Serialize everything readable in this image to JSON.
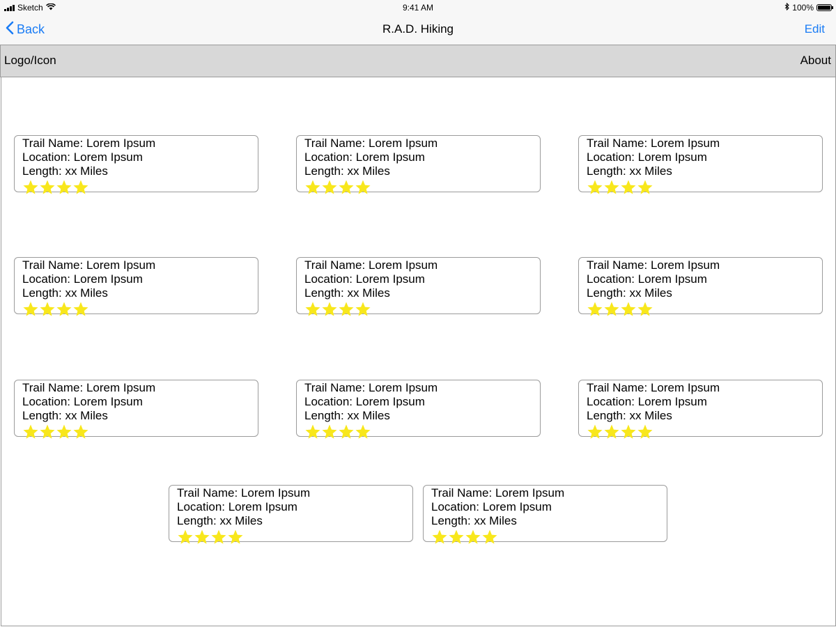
{
  "status_bar": {
    "carrier": "Sketch",
    "time": "9:41 AM",
    "battery_text": "100%",
    "battery_level": 1.0
  },
  "nav": {
    "back_label": "Back",
    "title": "R.A.D. Hiking",
    "edit_label": "Edit"
  },
  "header": {
    "logo_label": "Logo/Icon",
    "about_label": "About"
  },
  "colors": {
    "accent": "#1a7cf5",
    "star": "#f8e71c",
    "header_bg": "#d8d8d8"
  },
  "trails": [
    {
      "name": "Trail Name: Lorem Ipsum",
      "location": "Location: Lorem Ipsum",
      "length": "Length: xx Miles",
      "rating": 4
    },
    {
      "name": "Trail Name: Lorem Ipsum",
      "location": "Location: Lorem Ipsum",
      "length": "Length: xx Miles",
      "rating": 4
    },
    {
      "name": "Trail Name: Lorem Ipsum",
      "location": "Location: Lorem Ipsum",
      "length": "Length: xx Miles",
      "rating": 4
    },
    {
      "name": "Trail Name: Lorem Ipsum",
      "location": "Location: Lorem Ipsum",
      "length": "Length: xx Miles",
      "rating": 4
    },
    {
      "name": "Trail Name: Lorem Ipsum",
      "location": "Location: Lorem Ipsum",
      "length": "Length: xx Miles",
      "rating": 4
    },
    {
      "name": "Trail Name: Lorem Ipsum",
      "location": "Location: Lorem Ipsum",
      "length": "Length: xx Miles",
      "rating": 4
    },
    {
      "name": "Trail Name: Lorem Ipsum",
      "location": "Location: Lorem Ipsum",
      "length": "Length: xx Miles",
      "rating": 4
    },
    {
      "name": "Trail Name: Lorem Ipsum",
      "location": "Location: Lorem Ipsum",
      "length": "Length: xx Miles",
      "rating": 4
    },
    {
      "name": "Trail Name: Lorem Ipsum",
      "location": "Location: Lorem Ipsum",
      "length": "Length: xx Miles",
      "rating": 4
    },
    {
      "name": "Trail Name: Lorem Ipsum",
      "location": "Location: Lorem Ipsum",
      "length": "Length: xx Miles",
      "rating": 4
    },
    {
      "name": "Trail Name: Lorem Ipsum",
      "location": "Location: Lorem Ipsum",
      "length": "Length: xx Miles",
      "rating": 4
    }
  ]
}
